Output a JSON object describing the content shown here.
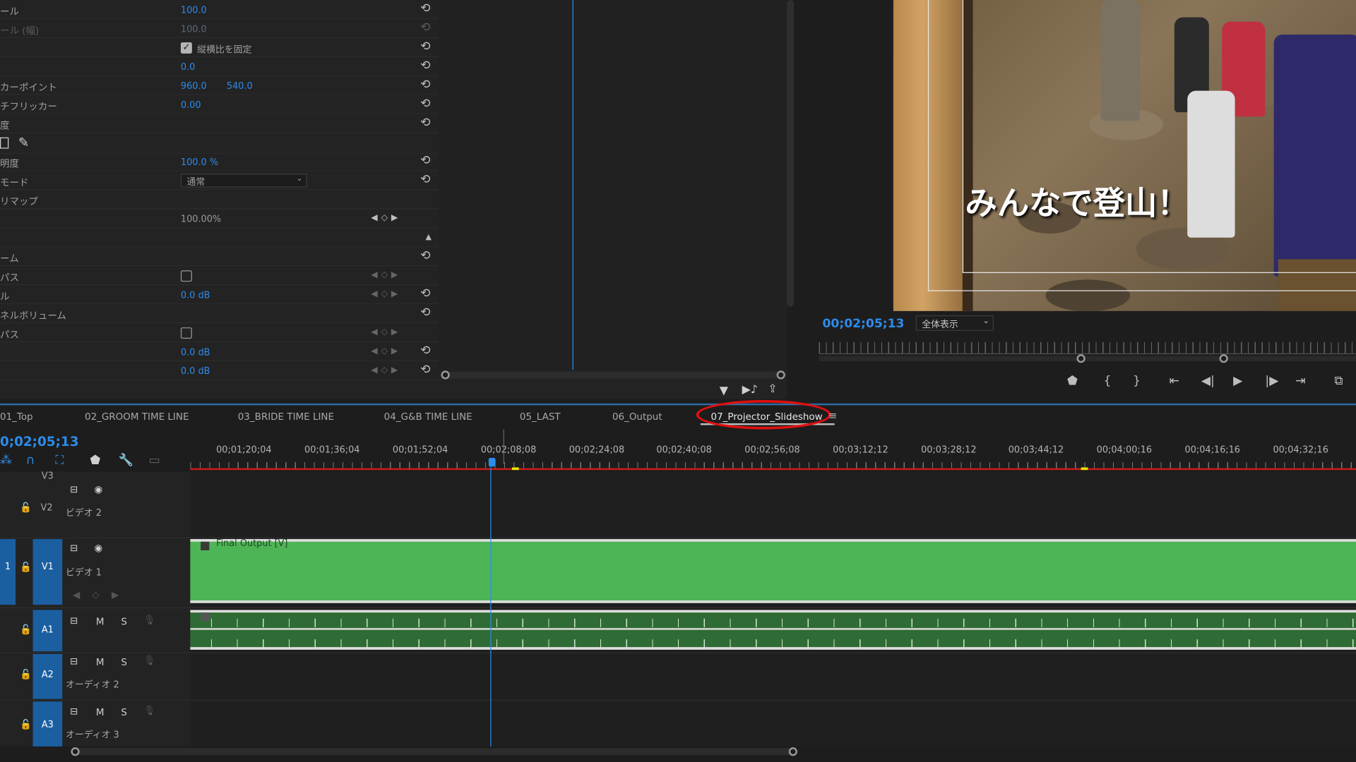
{
  "effect_controls": {
    "rows": [
      {
        "label": "ール",
        "value": "100.0"
      },
      {
        "label": "ール (幅)",
        "value": "100.0"
      },
      {
        "label": "",
        "checkbox_label": "縦横比を固定"
      },
      {
        "label": "",
        "value": "0.0"
      },
      {
        "label": "カーポイント",
        "value": "960.0",
        "value2": "540.0"
      },
      {
        "label": "チフリッカー",
        "value": "0.00"
      },
      {
        "label": "度"
      },
      {
        "label": ""
      },
      {
        "label": "明度",
        "value": "100.0 %"
      },
      {
        "label": "モード",
        "dropdown": "通常"
      },
      {
        "label": "リマップ"
      },
      {
        "label": "",
        "value": "100.00%"
      },
      {
        "label": ""
      },
      {
        "label": "ーム"
      },
      {
        "label": "パス"
      },
      {
        "label": "ル",
        "value": "0.0 dB"
      },
      {
        "label": "ネルボリューム"
      },
      {
        "label": "パス"
      },
      {
        "label": "",
        "value": "0.0 dB"
      },
      {
        "label": "",
        "value": "0.0 dB"
      }
    ]
  },
  "program": {
    "overlay_title": "みんなで登山！",
    "timecode": "00;02;05;13",
    "fit": "全体表示"
  },
  "tabs": [
    "01_Top",
    "02_GROOM TIME LINE",
    "03_BRIDE TIME LINE",
    "04_G&B TIME LINE",
    "05_LAST",
    "06_Output",
    "07_Projector_Slideshow"
  ],
  "timeline": {
    "timecode": "0;02;05;13",
    "ruler": [
      "00;01;20;04",
      "00;01;36;04",
      "00;01;52;04",
      "00;02;08;08",
      "00;02;24;08",
      "00;02;40;08",
      "00;02;56;08",
      "00;03;12;12",
      "00;03;28;12",
      "00;03;44;12",
      "00;04;00;16",
      "00;04;16;16",
      "00;04;32;16"
    ],
    "tracks": {
      "v3": {
        "id": "V3"
      },
      "v2": {
        "id": "V2",
        "name": "ビデオ 2"
      },
      "v1": {
        "id": "V1",
        "src": "1",
        "name": "ビデオ 1"
      },
      "a1": {
        "id": "A1"
      },
      "a2": {
        "id": "A2",
        "name": "オーディオ 2"
      },
      "a3": {
        "id": "A3",
        "name": "オーディオ 3"
      }
    },
    "mute": "M",
    "solo": "S",
    "clip_v1": "Final Output [V]"
  },
  "colors": {
    "accent": "#2d8ceb",
    "clip_video": "#4db556",
    "clip_audio": "#2f6b34",
    "highlight": "#e01010"
  }
}
